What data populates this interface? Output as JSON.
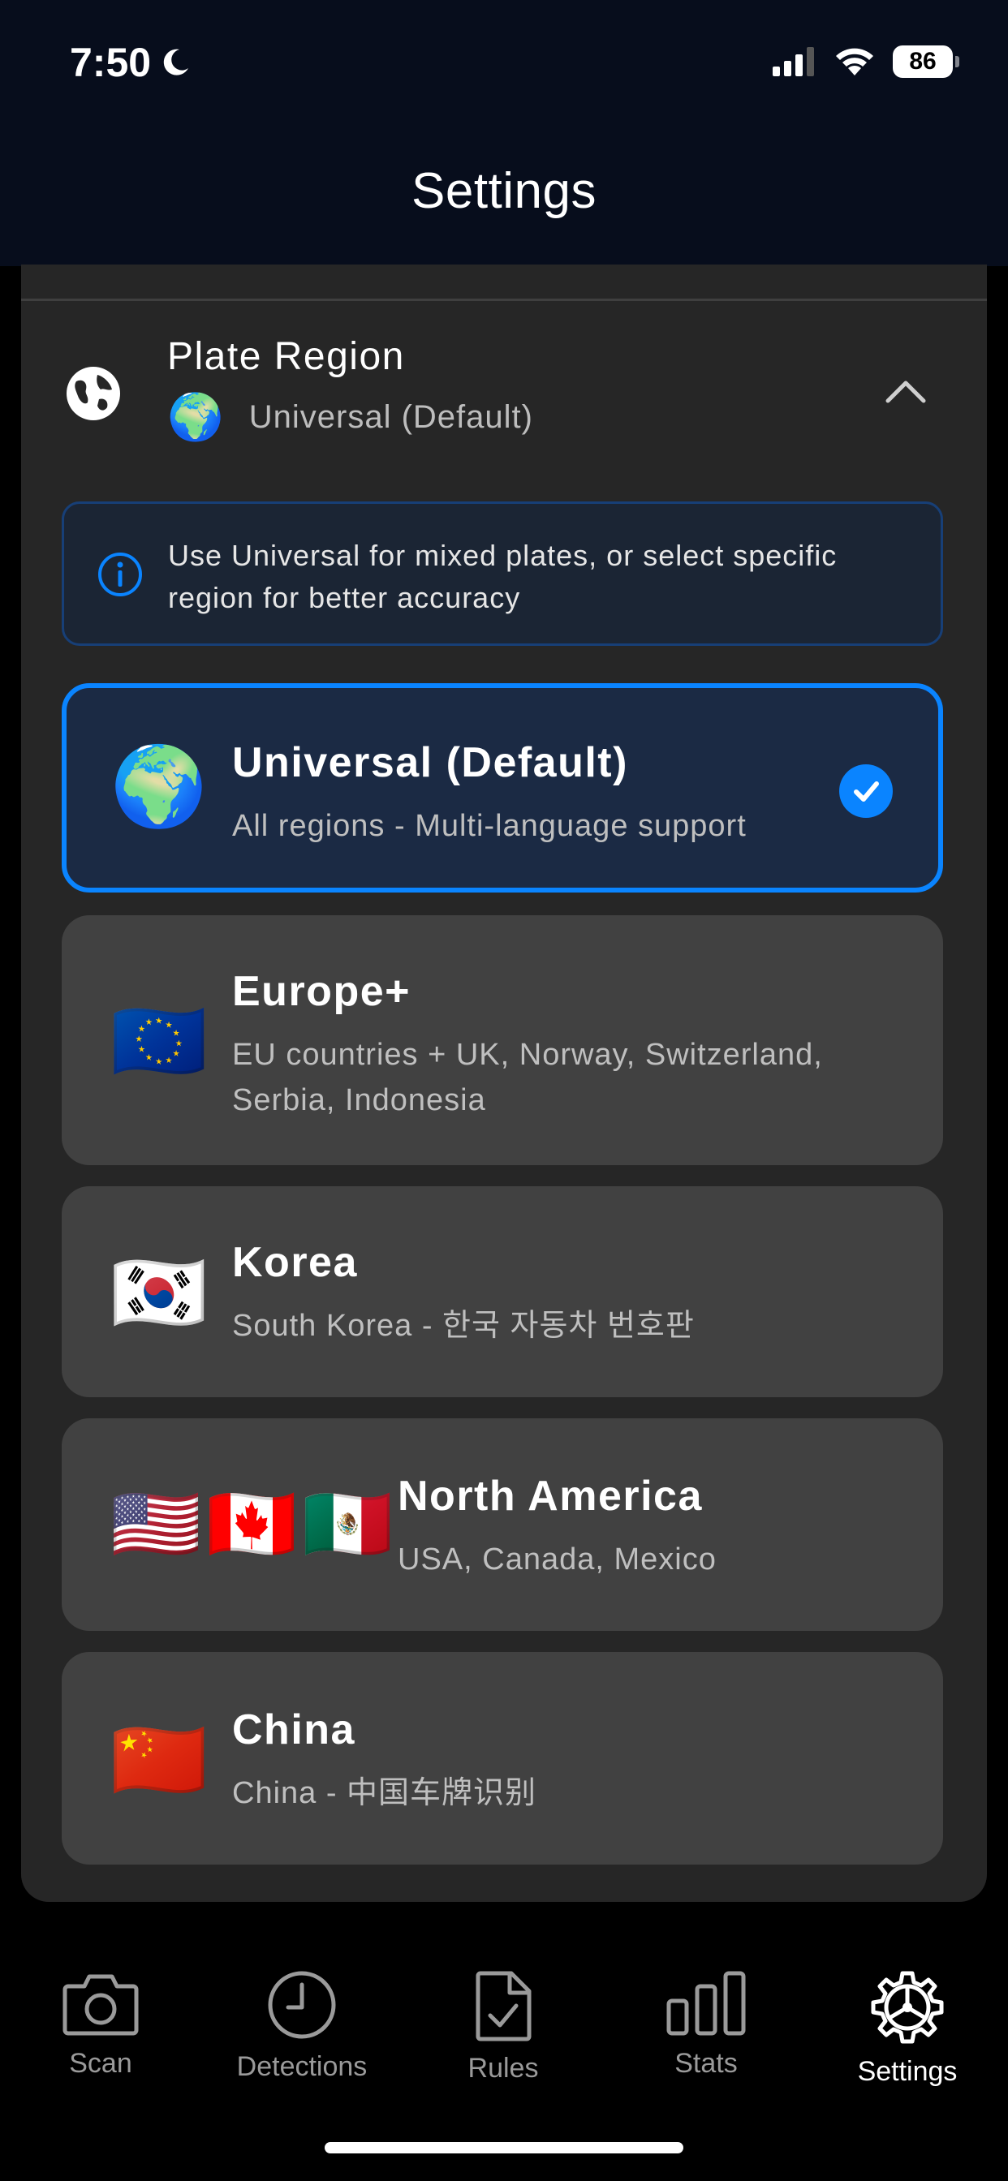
{
  "status_bar": {
    "time": "7:50",
    "battery": "86"
  },
  "header": {
    "title": "Settings"
  },
  "plate_region": {
    "title": "Plate Region",
    "current_emoji": "🌍",
    "current_value": "Universal (Default)",
    "info_text": "Use Universal for mixed plates, or select specific region for better accuracy",
    "options": [
      {
        "emoji": "🌍",
        "title": "Universal (Default)",
        "description": "All regions - Multi-language support",
        "selected": true
      },
      {
        "emoji": "🇪🇺",
        "title": "Europe+",
        "description": "EU countries + UK, Norway, Switzerland, Serbia, Indonesia",
        "selected": false
      },
      {
        "emoji": "🇰🇷",
        "title": "Korea",
        "description": "South Korea - 한국 자동차 번호판",
        "selected": false
      },
      {
        "emoji": "🇺🇸🇨🇦🇲🇽",
        "title": "North America",
        "description": "USA, Canada, Mexico",
        "selected": false
      },
      {
        "emoji": "🇨🇳",
        "title": "China",
        "description": "China - 中国车牌识别",
        "selected": false
      }
    ]
  },
  "tabs": [
    {
      "label": "Scan",
      "icon": "camera-icon",
      "active": false
    },
    {
      "label": "Detections",
      "icon": "clock-icon",
      "active": false
    },
    {
      "label": "Rules",
      "icon": "document-check-icon",
      "active": false
    },
    {
      "label": "Stats",
      "icon": "bar-chart-icon",
      "active": false
    },
    {
      "label": "Settings",
      "icon": "gear-icon",
      "active": true
    }
  ],
  "colors": {
    "accent": "#0a84ff",
    "background": "#000000",
    "card": "#262626",
    "option": "#414141",
    "selected_option": "#1b2a44"
  }
}
